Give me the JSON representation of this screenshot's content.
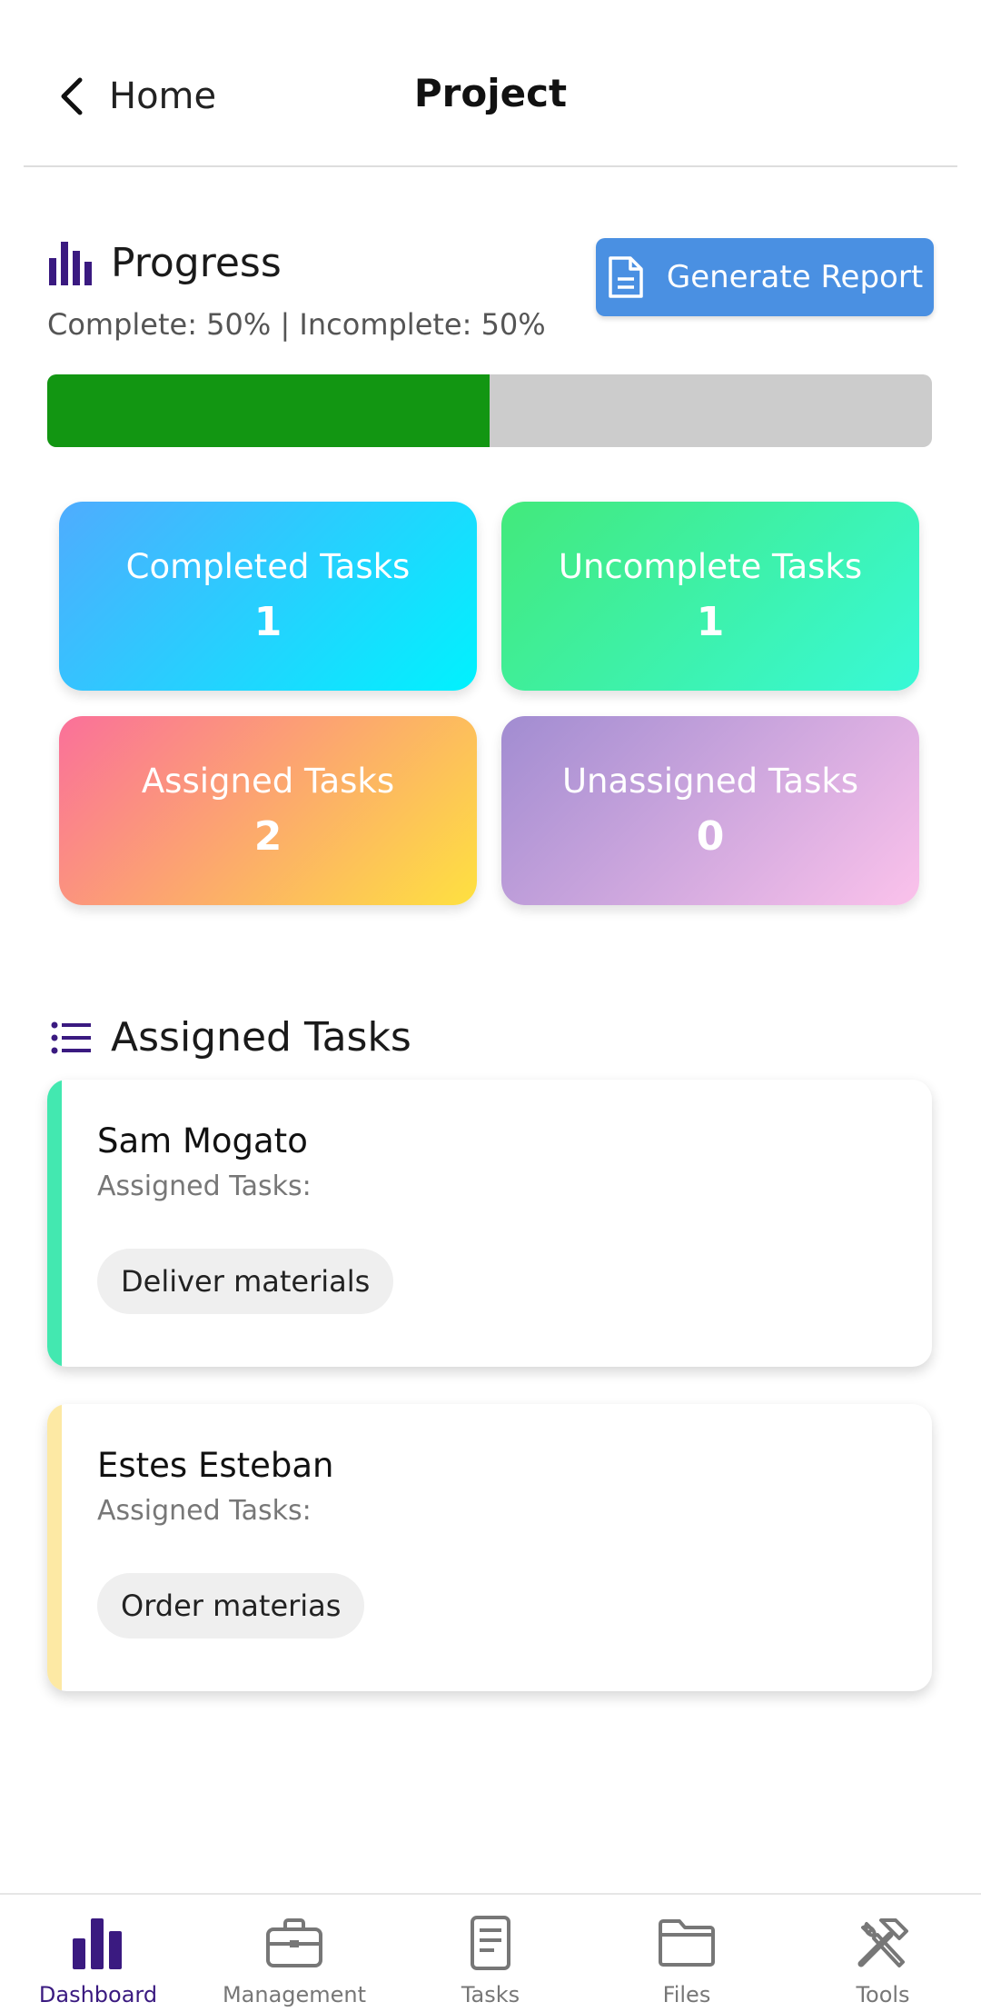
{
  "header": {
    "back_label": "Home",
    "title": "Project"
  },
  "progress": {
    "title": "Progress",
    "summary": "Complete: 50% | Incomplete: 50%",
    "complete_fraction": 0.5,
    "report_button": "Generate Report"
  },
  "stats": [
    {
      "label": "Completed Tasks",
      "value": "1"
    },
    {
      "label": "Uncomplete Tasks",
      "value": "1"
    },
    {
      "label": "Assigned Tasks",
      "value": "2"
    },
    {
      "label": "Unassigned Tasks",
      "value": "0"
    }
  ],
  "assigned": {
    "title": "Assigned Tasks",
    "people": [
      {
        "name": "Sam Mogato",
        "sub": "Assigned Tasks:",
        "tasks": [
          "Deliver materials"
        ],
        "accent": "#43e8b0"
      },
      {
        "name": "Estes Esteban",
        "sub": "Assigned Tasks:",
        "tasks": [
          "Order materias"
        ],
        "accent": "#fde9a4"
      }
    ]
  },
  "nav": {
    "items": [
      {
        "label": "Dashboard",
        "icon": "bar-chart-icon",
        "active": true
      },
      {
        "label": "Management",
        "icon": "briefcase-icon",
        "active": false
      },
      {
        "label": "Tasks",
        "icon": "document-icon",
        "active": false
      },
      {
        "label": "Files",
        "icon": "folder-icon",
        "active": false
      },
      {
        "label": "Tools",
        "icon": "tools-icon",
        "active": false
      }
    ]
  },
  "colors": {
    "accent_purple": "#3a1a80",
    "report_button": "#4a90e2",
    "progress_fill": "#129612",
    "progress_track": "#cccccc"
  }
}
